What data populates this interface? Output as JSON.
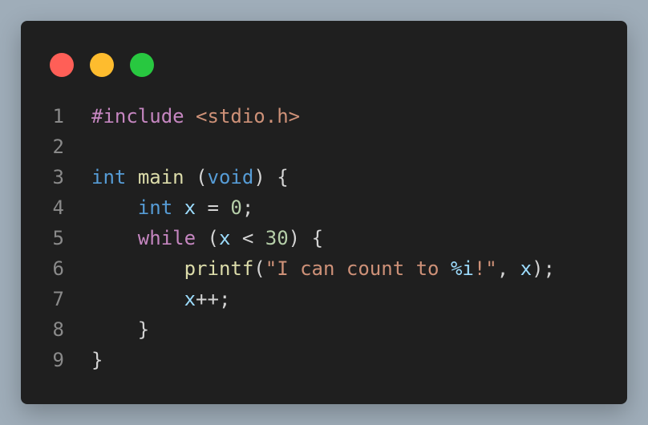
{
  "window": {
    "controls": {
      "close_color": "#ff5f57",
      "minimize_color": "#febc2e",
      "maximize_color": "#28c840"
    }
  },
  "code": {
    "language": "c",
    "lines": [
      {
        "number": "1",
        "tokens": [
          {
            "text": "#include",
            "kind": "preproc"
          },
          {
            "text": " ",
            "kind": "punct"
          },
          {
            "text": "<stdio.h>",
            "kind": "include"
          }
        ]
      },
      {
        "number": "2",
        "tokens": []
      },
      {
        "number": "3",
        "tokens": [
          {
            "text": "int",
            "kind": "type"
          },
          {
            "text": " ",
            "kind": "punct"
          },
          {
            "text": "main",
            "kind": "func"
          },
          {
            "text": " (",
            "kind": "punct"
          },
          {
            "text": "void",
            "kind": "type"
          },
          {
            "text": ") {",
            "kind": "punct"
          }
        ]
      },
      {
        "number": "4",
        "tokens": [
          {
            "text": "    ",
            "kind": "punct"
          },
          {
            "text": "int",
            "kind": "type"
          },
          {
            "text": " ",
            "kind": "punct"
          },
          {
            "text": "x",
            "kind": "var"
          },
          {
            "text": " = ",
            "kind": "punct"
          },
          {
            "text": "0",
            "kind": "num"
          },
          {
            "text": ";",
            "kind": "punct"
          }
        ]
      },
      {
        "number": "5",
        "tokens": [
          {
            "text": "    ",
            "kind": "punct"
          },
          {
            "text": "while",
            "kind": "kw"
          },
          {
            "text": " (",
            "kind": "punct"
          },
          {
            "text": "x",
            "kind": "var"
          },
          {
            "text": " < ",
            "kind": "punct"
          },
          {
            "text": "30",
            "kind": "num"
          },
          {
            "text": ") {",
            "kind": "punct"
          }
        ]
      },
      {
        "number": "6",
        "tokens": [
          {
            "text": "        ",
            "kind": "punct"
          },
          {
            "text": "printf",
            "kind": "func"
          },
          {
            "text": "(",
            "kind": "punct"
          },
          {
            "text": "\"I can count to ",
            "kind": "str"
          },
          {
            "text": "%i",
            "kind": "fmt"
          },
          {
            "text": "!\"",
            "kind": "str"
          },
          {
            "text": ", ",
            "kind": "punct"
          },
          {
            "text": "x",
            "kind": "var"
          },
          {
            "text": ");",
            "kind": "punct"
          }
        ]
      },
      {
        "number": "7",
        "tokens": [
          {
            "text": "        ",
            "kind": "punct"
          },
          {
            "text": "x",
            "kind": "var"
          },
          {
            "text": "++;",
            "kind": "punct"
          }
        ]
      },
      {
        "number": "8",
        "tokens": [
          {
            "text": "    }",
            "kind": "punct"
          }
        ]
      },
      {
        "number": "9",
        "tokens": [
          {
            "text": "}",
            "kind": "punct"
          }
        ]
      }
    ]
  }
}
